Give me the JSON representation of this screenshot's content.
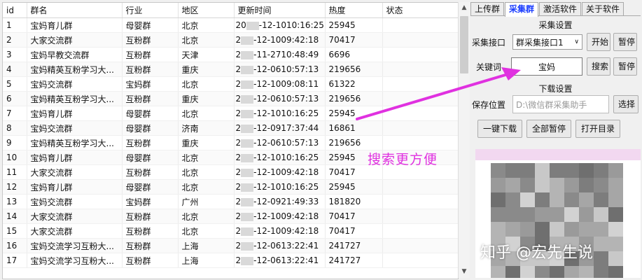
{
  "table": {
    "columns": [
      "id",
      "群名",
      "行业",
      "地区",
      "更新时间",
      "热度",
      "状态"
    ],
    "rows": [
      [
        "1",
        "宝妈育儿群",
        "母婴群",
        "北京",
        "20",
        "-12-1010:16:25",
        "25945",
        ""
      ],
      [
        "2",
        "大家交流群",
        "互粉群",
        "北京",
        "2",
        "-12-1009:42:18",
        "70417",
        ""
      ],
      [
        "3",
        "宝妈早教交流群",
        "互粉群",
        "天津",
        "2",
        "-11-2710:48:49",
        "6696",
        ""
      ],
      [
        "4",
        "宝妈精英互粉学习大...",
        "互粉群",
        "重庆",
        "2",
        "-12-0610:57:13",
        "219656",
        ""
      ],
      [
        "5",
        "宝妈交流群",
        "宝妈群",
        "北京",
        "2",
        "-12-1009:08:11",
        "61322",
        ""
      ],
      [
        "6",
        "宝妈精英互粉学习大...",
        "互粉群",
        "重庆",
        "2",
        "-12-0610:57:13",
        "219656",
        ""
      ],
      [
        "7",
        "宝妈育儿群",
        "母婴群",
        "北京",
        "2",
        "-12-1010:16:25",
        "25945",
        ""
      ],
      [
        "8",
        "宝妈交流群",
        "母婴群",
        "济南",
        "2",
        "-12-0917:37:44",
        "16861",
        ""
      ],
      [
        "9",
        "宝妈精英互粉学习大...",
        "互粉群",
        "重庆",
        "2",
        "-12-0610:57:13",
        "219656",
        ""
      ],
      [
        "10",
        "宝妈育儿群",
        "母婴群",
        "北京",
        "2",
        "-12-1010:16:25",
        "25945",
        ""
      ],
      [
        "11",
        "大家交流群",
        "互粉群",
        "北京",
        "2",
        "-12-1009:42:18",
        "70417",
        ""
      ],
      [
        "12",
        "宝妈育儿群",
        "母婴群",
        "北京",
        "2",
        "-12-1010:16:25",
        "25945",
        ""
      ],
      [
        "13",
        "宝妈交流群",
        "宝妈群",
        "广州",
        "2",
        "-12-0921:49:33",
        "181820",
        ""
      ],
      [
        "14",
        "大家交流群",
        "互粉群",
        "北京",
        "2",
        "-12-1009:42:18",
        "70417",
        ""
      ],
      [
        "15",
        "大家交流群",
        "互粉群",
        "北京",
        "2",
        "-12-1009:42:18",
        "70417",
        ""
      ],
      [
        "16",
        "宝妈交流学习互粉大...",
        "互粉群",
        "上海",
        "2",
        "-12-0613:22:41",
        "241727",
        ""
      ],
      [
        "17",
        "宝妈交流学习互粉大...",
        "互粉群",
        "上海",
        "2",
        "-12-0613:22:41",
        "241727",
        ""
      ]
    ]
  },
  "tabs": [
    {
      "label": "上传群",
      "active": false
    },
    {
      "label": "采集群",
      "active": true
    },
    {
      "label": "激活软件",
      "active": false
    },
    {
      "label": "关于软件",
      "active": false
    }
  ],
  "collect": {
    "section_title": "采集设置",
    "api_label": "采集接口",
    "api_value": "群采集接口1",
    "start_button": "开始",
    "pause_button": "暂停",
    "keyword_label": "关键词",
    "keyword_value": "宝妈",
    "search_button": "搜索",
    "pause2_button": "暂停"
  },
  "download": {
    "section_title": "下载设置",
    "save_label": "保存位置",
    "save_path": "D:\\微信群采集助手",
    "choose_button": "选择",
    "one_click_button": "一键下载",
    "pause_all_button": "全部暂停",
    "open_dir_button": "打开目录"
  },
  "annotation": "搜索更方便",
  "watermark": "知乎 @宏先生说",
  "colors": {
    "accent_tab": "#1a3cff",
    "annotation": "#e031e0"
  }
}
